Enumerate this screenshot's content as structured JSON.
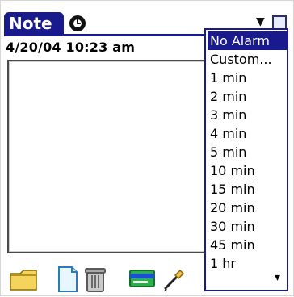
{
  "header": {
    "tab_label": "Note",
    "alarm_icon": "alarm-clock-icon",
    "alarm_dropdown_icon": "chevron-down-icon",
    "alarm_box_icon": "alarm-box-icon"
  },
  "note": {
    "timestamp": "4/20/04 10:23 am"
  },
  "alarm_menu": {
    "items": [
      "No Alarm",
      "Custom...",
      "1 min",
      "2 min",
      "3 min",
      "4 min",
      "5 min",
      "10 min",
      "15 min",
      "20 min",
      "30 min",
      "45 min",
      "1 hr"
    ],
    "selected": "No Alarm",
    "more_indicator": "▾"
  },
  "toolbar": {
    "icons": [
      "folder-icon",
      "new-document-icon",
      "trash-icon",
      "card-icon",
      "pen-tool-icon"
    ]
  },
  "colors": {
    "accent": "#1a1a8f",
    "text": "#000000",
    "background": "#ffffff"
  }
}
